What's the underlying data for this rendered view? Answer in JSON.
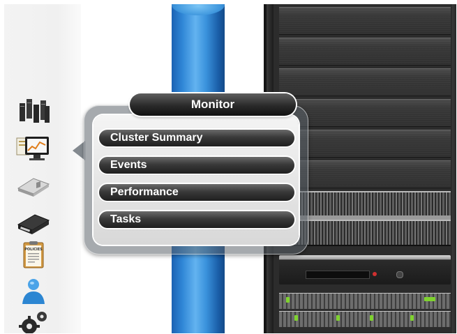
{
  "popup": {
    "title": "Monitor",
    "items": [
      {
        "label": "Cluster Summary"
      },
      {
        "label": "Events"
      },
      {
        "label": "Performance"
      },
      {
        "label": "Tasks"
      }
    ]
  },
  "dock": {
    "icons": [
      "servers-icon",
      "monitor-chart-icon",
      "storage-pool-icon",
      "volume-drive-icon",
      "policies-icon",
      "user-icon",
      "settings-gears-icon"
    ],
    "policies_icon_text": "POLICIES"
  },
  "colors": {
    "cylinder_blue": "#3a92dc",
    "menu_dark": "#2a2a2a",
    "menu_text": "#ffffff"
  }
}
